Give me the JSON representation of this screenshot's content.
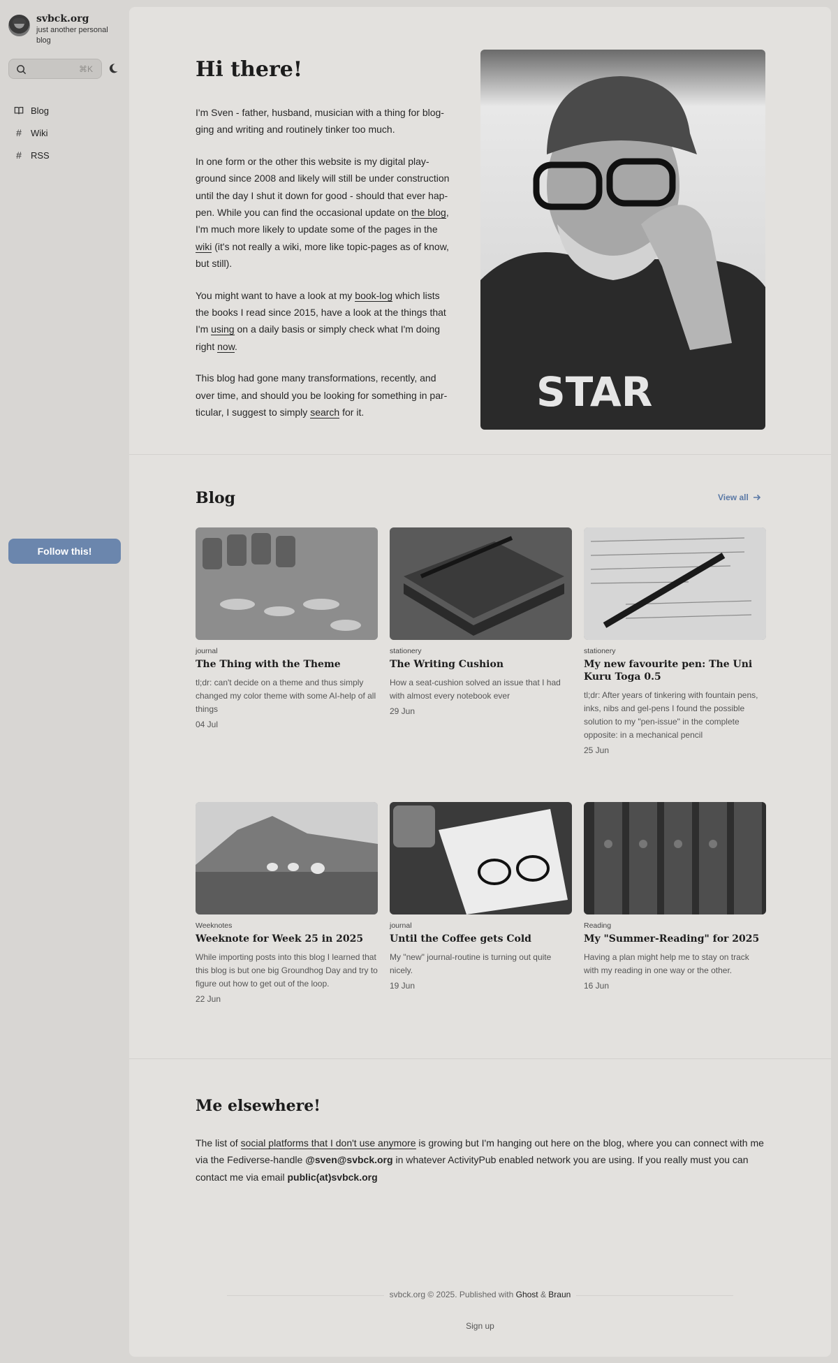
{
  "site": {
    "title": "svbck.org",
    "tagline": "just another personal blog",
    "search_shortcut": "⌘K",
    "follow_label": "Follow this!"
  },
  "nav": [
    {
      "label": "Blog",
      "icon": "book-icon"
    },
    {
      "label": "Wiki",
      "icon": "hash-icon"
    },
    {
      "label": "RSS",
      "icon": "hash-icon"
    }
  ],
  "hero": {
    "title": "Hi there!",
    "p1": "I'm Sven - father, husband, musician with a thing for blog-ging and writing and routinely tinker too much.",
    "p2_a": "In one form or the other this website is my digital play-ground since 2008 and likely will still be under construction until the day I shut it down for good - should that ever hap-pen. While you can find the occasional update on ",
    "p2_link1": "the blog",
    "p2_b": ", I'm much more likely to update some of the pages in the ",
    "p2_link2": "wiki",
    "p2_c": " (it's not really a wiki, more like topic-pages as of know, but still).",
    "p3_a": "You might want to have a look at my ",
    "p3_link1": "book-log",
    "p3_b": " which lists the books I read since 2015, have a look at the things that I'm ",
    "p3_link2": "using",
    "p3_c": " on a daily basis or simply check what I'm doing right ",
    "p3_link3": "now",
    "p3_d": ".",
    "p4_a": "This blog had gone many transformations, recently, and over time, and should you be looking for something in par-ticular, I suggest to simply ",
    "p4_link": "search",
    "p4_b": " for it."
  },
  "blog": {
    "title": "Blog",
    "view_all": "View all",
    "posts": [
      {
        "tag": "journal",
        "title": "The Thing with the Theme",
        "excerpt": "tl;dr: can't decide on a theme and thus simply changed my color theme with some AI-help of all things",
        "date": "04 Jul"
      },
      {
        "tag": "stationery",
        "title": "The Writing Cushion",
        "excerpt": "How a seat-cushion solved an issue that I had with almost every notebook ever",
        "date": "29 Jun"
      },
      {
        "tag": "stationery",
        "title": "My new favourite pen: The Uni Kuru Toga 0.5",
        "excerpt": "tl;dr: After years of tinkering with fountain pens, inks, nibs and gel-pens I found the possible solution to my \"pen-issue\" in the complete opposite: in a mechanical pencil",
        "date": "25 Jun"
      },
      {
        "tag": "Weeknotes",
        "title": "Weeknote for Week 25 in 2025",
        "excerpt": "While importing posts into this blog I learned that this blog is but one big Groundhog Day and try to figure out how to get out of the loop.",
        "date": "22 Jun"
      },
      {
        "tag": "journal",
        "title": "Until the Coffee gets Cold",
        "excerpt": "My \"new\" journal-routine is turning out quite nicely.",
        "date": "19 Jun"
      },
      {
        "tag": "Reading",
        "title": "My \"Summer-Reading\" for 2025",
        "excerpt": "Having a plan might help me to stay on track with my reading in one way or the other.",
        "date": "16 Jun"
      }
    ]
  },
  "elsewhere": {
    "title": "Me elsewhere!",
    "text_a": "The list of ",
    "link": "social platforms that I don't use anymore",
    "text_b": " is growing but I'm hanging out here on the blog, where you can connect with me via the Fediverse-handle ",
    "handle": "@sven@svbck.org",
    "text_c": " in whatever ActivityPub enabled network you are using. If you really must you can contact me via email ",
    "email": "public(at)svbck.org"
  },
  "footer": {
    "text_a": "svbck.org © 2025. Published with ",
    "ghost": "Ghost",
    "amp": " & ",
    "braun": "Braun",
    "signup": "Sign up"
  }
}
